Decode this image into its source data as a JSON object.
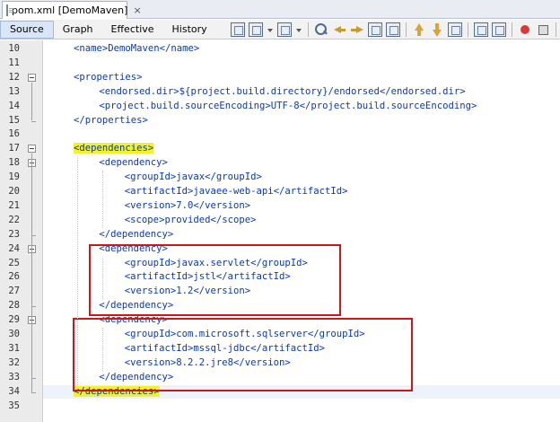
{
  "file_tab": {
    "title": "pom.xml [DemoMaven]",
    "close": "×"
  },
  "view_tabs": [
    "Source",
    "Graph",
    "Effective",
    "History"
  ],
  "toolbar_icons": [
    "history-icon",
    "back-icon",
    "forward-icon",
    "find-icon",
    "find-prev-icon",
    "find-next-icon",
    "toggle-highlight-icon",
    "toggle-bookmark-icon",
    "prev-bookmark-icon",
    "next-bookmark-icon",
    "shift-left-icon",
    "shift-right-icon",
    "record-macro-icon",
    "stop-macro-icon",
    "comment-icon",
    "check-xml-icon"
  ],
  "editor": {
    "lines": [
      {
        "n": "10",
        "indent": 2,
        "text": "<name>DemoMaven</name>"
      },
      {
        "n": "11",
        "indent": 0,
        "text": ""
      },
      {
        "n": "12",
        "indent": 2,
        "text": "<properties>",
        "fold": true
      },
      {
        "n": "13",
        "indent": 3,
        "text": "<endorsed.dir>${project.build.directory}/endorsed</endorsed.dir>"
      },
      {
        "n": "14",
        "indent": 3,
        "text": "<project.build.sourceEncoding>UTF-8</project.build.sourceEncoding>"
      },
      {
        "n": "15",
        "indent": 2,
        "text": "</properties>"
      },
      {
        "n": "16",
        "indent": 0,
        "text": ""
      },
      {
        "n": "17",
        "indent": 2,
        "text": "<dependencies>",
        "fold": true,
        "highlight": true
      },
      {
        "n": "18",
        "indent": 3,
        "text": "<dependency>",
        "fold": true
      },
      {
        "n": "19",
        "indent": 4,
        "text": "<groupId>javax</groupId>"
      },
      {
        "n": "20",
        "indent": 4,
        "text": "<artifactId>javaee-web-api</artifactId>"
      },
      {
        "n": "21",
        "indent": 4,
        "text": "<version>7.0</version>"
      },
      {
        "n": "22",
        "indent": 4,
        "text": "<scope>provided</scope>"
      },
      {
        "n": "23",
        "indent": 3,
        "text": "</dependency>"
      },
      {
        "n": "24",
        "indent": 3,
        "text": "<dependency>",
        "fold": true
      },
      {
        "n": "25",
        "indent": 4,
        "text": "<groupId>javax.servlet</groupId>"
      },
      {
        "n": "26",
        "indent": 4,
        "text": "<artifactId>jstl</artifactId>"
      },
      {
        "n": "27",
        "indent": 4,
        "text": "<version>1.2</version>"
      },
      {
        "n": "28",
        "indent": 3,
        "text": "</dependency>"
      },
      {
        "n": "29",
        "indent": 3,
        "text": "<dependency>",
        "fold": true
      },
      {
        "n": "30",
        "indent": 4,
        "text": "<groupId>com.microsoft.sqlserver</groupId>"
      },
      {
        "n": "31",
        "indent": 4,
        "text": "<artifactId>mssql-jdbc</artifactId>"
      },
      {
        "n": "32",
        "indent": 4,
        "text": "<version>8.2.2.jre8</version>"
      },
      {
        "n": "33",
        "indent": 3,
        "text": "</dependency>"
      },
      {
        "n": "34",
        "indent": 2,
        "text": "</dependencies>",
        "highlight": true
      },
      {
        "n": "35",
        "indent": 0,
        "text": ""
      }
    ]
  },
  "colors": {
    "tag": "#0b3aa8",
    "match_highlight": "#f2f22a",
    "annotation_box": "#c8181e"
  }
}
